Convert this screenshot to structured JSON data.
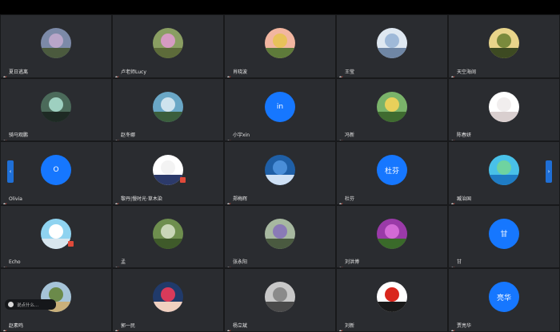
{
  "window": {
    "background": "#000000",
    "tile_color": "#2a2c30",
    "accent": "#1677ff"
  },
  "participants": [
    {
      "name": "夏日逃离",
      "avatar": "image",
      "icon": "flowers-photo"
    },
    {
      "name": "卢老师Lucy",
      "avatar": "image",
      "icon": "pink-flower-photo"
    },
    {
      "name": "肖晓波",
      "avatar": "image",
      "icon": "sunflower-sunset-photo"
    },
    {
      "name": "王莹",
      "avatar": "image",
      "icon": "frost-tree-photo"
    },
    {
      "name": "天空海阔",
      "avatar": "image",
      "icon": "sunlit-forest-photo"
    },
    {
      "name": "骑马观鹏",
      "avatar": "image",
      "icon": "cave-photo"
    },
    {
      "name": "赵冬娜",
      "avatar": "image",
      "icon": "lake-photo"
    },
    {
      "name": "小宇xin",
      "avatar": "letter",
      "letter": "in"
    },
    {
      "name": "冯新",
      "avatar": "image",
      "icon": "person-photo"
    },
    {
      "name": "陈春妍",
      "avatar": "image",
      "icon": "rabbit-photo"
    },
    {
      "name": "Olivia",
      "avatar": "letter",
      "letter": "O"
    },
    {
      "name": "黎丹|慢时光·草木染",
      "avatar": "image",
      "icon": "logo-photo"
    },
    {
      "name": "郑梅辉",
      "avatar": "image",
      "icon": "blue-paper-photo"
    },
    {
      "name": "杜芬",
      "avatar": "letter",
      "letter": "杜芬"
    },
    {
      "name": "臧治国",
      "avatar": "image",
      "icon": "bird-lake-photo"
    },
    {
      "name": "Echo",
      "avatar": "image",
      "icon": "beach-photo"
    },
    {
      "name": "孟",
      "avatar": "image",
      "icon": "trees-photo"
    },
    {
      "name": "张永阳",
      "avatar": "image",
      "icon": "portrait-photo"
    },
    {
      "name": "刘洪博",
      "avatar": "image",
      "icon": "orchid-photo"
    },
    {
      "name": "甘",
      "avatar": "letter",
      "letter": "甘"
    },
    {
      "name": "赵素鸣",
      "avatar": "image",
      "icon": "pavilion-photo"
    },
    {
      "name": "郭一民",
      "avatar": "image",
      "icon": "woman-red-photo"
    },
    {
      "name": "杨立斌",
      "avatar": "image",
      "icon": "street-photo"
    },
    {
      "name": "刘新",
      "avatar": "image",
      "icon": "angry-bird-photo"
    },
    {
      "name": "贾亮华",
      "avatar": "letter",
      "letter": "亮华"
    }
  ],
  "controls": {
    "prev_arrow": "‹",
    "next_arrow": "›",
    "chat_placeholder": "说点什么..."
  }
}
